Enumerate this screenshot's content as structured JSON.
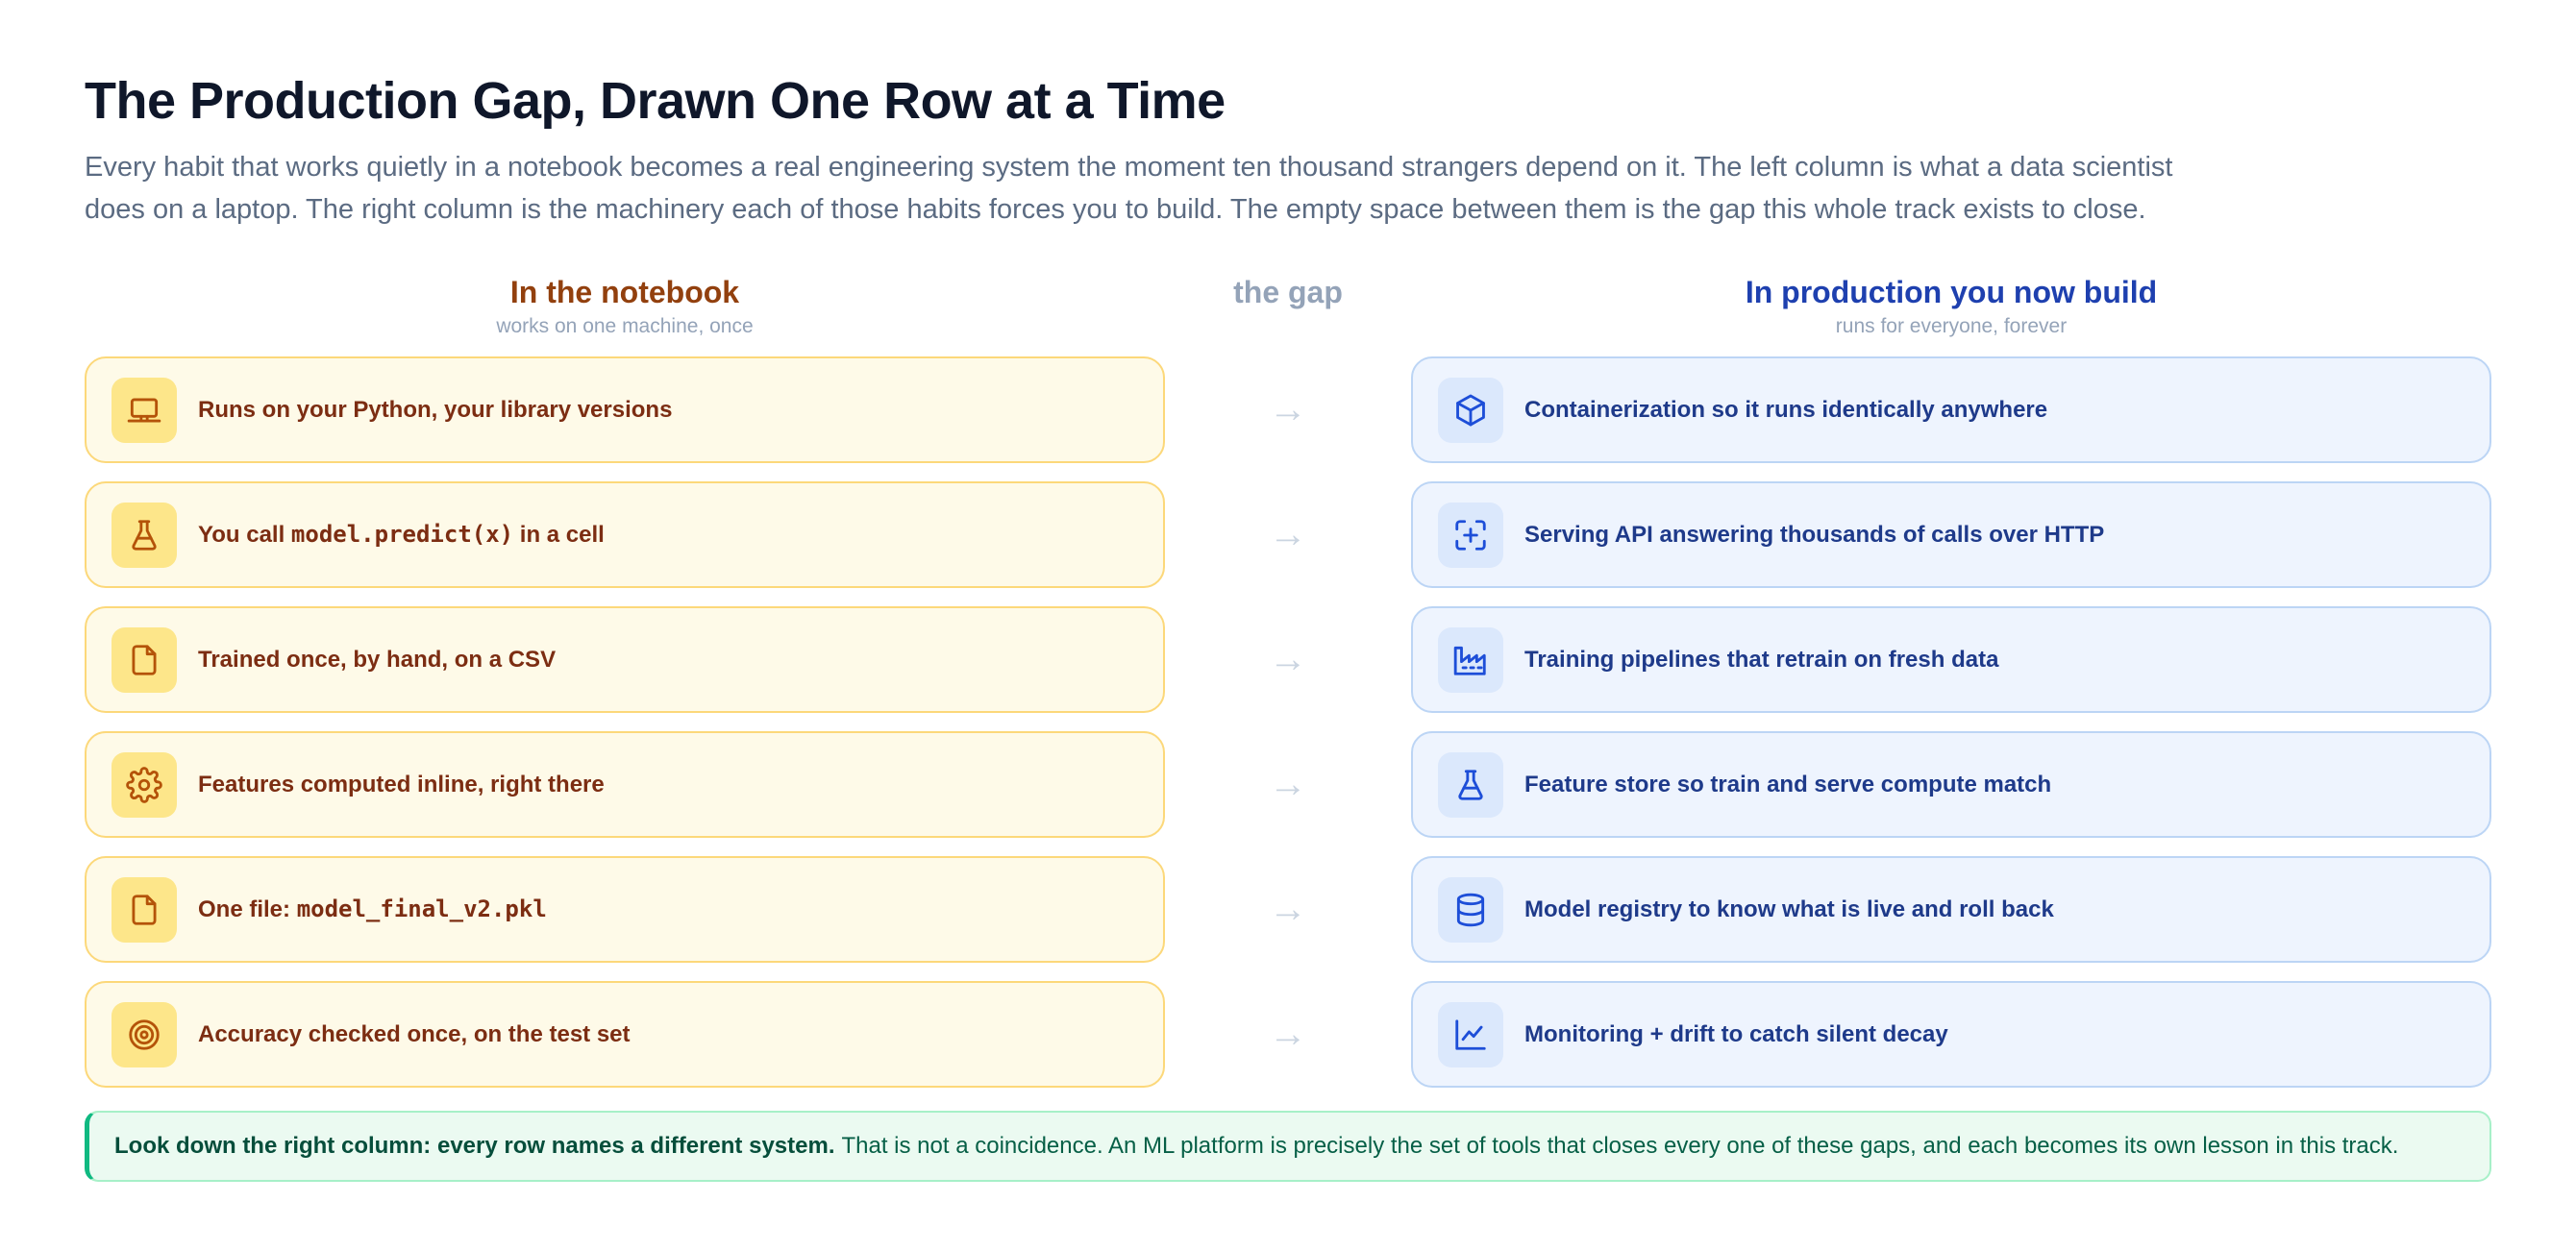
{
  "title": "The Production Gap, Drawn One Row at a Time",
  "subtitle": "Every habit that works quietly in a notebook becomes a real engineering system the moment ten thousand strangers depend on it. The left column is what a data scientist does on a laptop. The right column is the machinery each of those habits forces you to build. The empty space between them is the gap this whole track exists to close.",
  "columns": {
    "left": {
      "heading": "In the notebook",
      "sub": "works on one machine, once"
    },
    "middle": {
      "heading": "the gap"
    },
    "right": {
      "heading": "In production you now build",
      "sub": "runs for everyone, forever"
    }
  },
  "arrow": "→",
  "rows": [
    {
      "left": {
        "icon": "laptop-icon",
        "text": "Runs on your Python, your library versions"
      },
      "right": {
        "icon": "box-icon",
        "text": "Containerization so it runs identically anywhere"
      }
    },
    {
      "left": {
        "icon": "flask-icon",
        "pre": "You call ",
        "code": "model.predict(x)",
        "post": " in a cell"
      },
      "right": {
        "icon": "scan-plus-icon",
        "text": "Serving API answering thousands of calls over HTTP"
      }
    },
    {
      "left": {
        "icon": "file-icon",
        "text": "Trained once, by hand, on a CSV"
      },
      "right": {
        "icon": "factory-icon",
        "text": "Training pipelines that retrain on fresh data"
      }
    },
    {
      "left": {
        "icon": "gear-icon",
        "text": "Features computed inline, right there"
      },
      "right": {
        "icon": "flask-icon",
        "text": "Feature store so train and serve compute match"
      }
    },
    {
      "left": {
        "icon": "file-icon",
        "pre": "One file: ",
        "code": "model_final_v2.pkl",
        "post": ""
      },
      "right": {
        "icon": "database-icon",
        "text": "Model registry to know what is live and roll back"
      }
    },
    {
      "left": {
        "icon": "target-icon",
        "text": "Accuracy checked once, on the test set"
      },
      "right": {
        "icon": "line-chart-icon",
        "text": "Monitoring + drift to catch silent decay"
      }
    }
  ],
  "callout": {
    "bold": "Look down the right column: every row names a different system.",
    "text": "That is not a coincidence. An ML platform is precisely the set of tools that closes every one of these gaps, and each becomes its own lesson in this track."
  },
  "colors": {
    "left_bg": "#fefae8",
    "left_border": "#fcd87a",
    "left_text": "#7c2d12",
    "right_bg": "#eef4fe",
    "right_border": "#bcd5f5",
    "right_text": "#1e3a8a",
    "callout_accent": "#10b981"
  }
}
